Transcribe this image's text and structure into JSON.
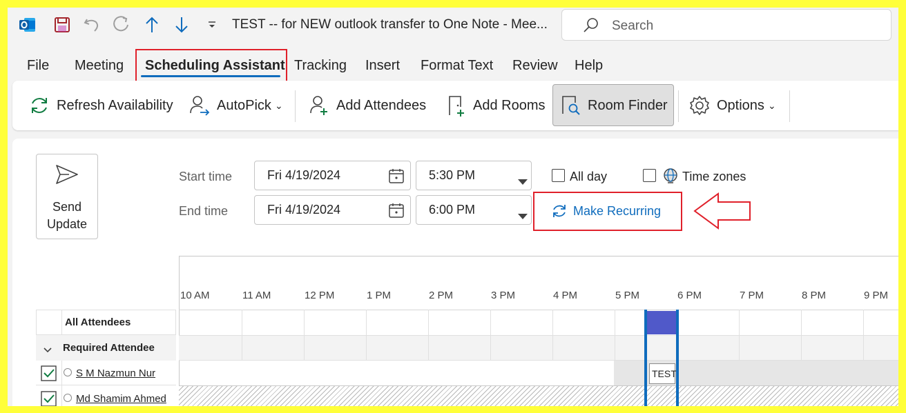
{
  "titlebar": {
    "title": "TEST -- for NEW outlook transfer to One Note  -  Mee...",
    "search_placeholder": "Search",
    "quick_access": [
      "outlook-logo-icon",
      "save-icon",
      "undo-icon",
      "redo-icon",
      "up-arrow-icon",
      "down-arrow-icon",
      "customize-dropdown-icon"
    ]
  },
  "tabs": [
    {
      "label": "File"
    },
    {
      "label": "Meeting"
    },
    {
      "label": "Scheduling Assistant",
      "active": true
    },
    {
      "label": "Tracking"
    },
    {
      "label": "Insert"
    },
    {
      "label": "Format Text"
    },
    {
      "label": "Review"
    },
    {
      "label": "Help"
    }
  ],
  "ribbon": {
    "refresh": "Refresh Availability",
    "autopick": "AutoPick",
    "add_attendees": "Add Attendees",
    "add_rooms": "Add Rooms",
    "room_finder": "Room Finder",
    "options": "Options"
  },
  "form": {
    "send_update_line1": "Send",
    "send_update_line2": "Update",
    "start_label": "Start time",
    "end_label": "End time",
    "start_date": "Fri 4/19/2024",
    "start_time": "5:30 PM",
    "end_date": "Fri 4/19/2024",
    "end_time": "6:00 PM",
    "all_day": "All day",
    "all_day_checked": false,
    "time_zones": "Time zones",
    "time_zones_checked": false,
    "make_recurring": "Make Recurring"
  },
  "schedule": {
    "hours": [
      "10 AM",
      "11 AM",
      "12 PM",
      "1 PM",
      "2 PM",
      "3 PM",
      "4 PM",
      "5 PM",
      "6 PM",
      "7 PM",
      "8 PM",
      "9 PM"
    ],
    "all_attendees": "All Attendees",
    "required_group": "Required Attendee",
    "attendees": [
      {
        "name": "S M Nazmun Nur",
        "checked": true,
        "busy_label": "TEST"
      },
      {
        "name": "Md Shamim Ahmed",
        "checked": true
      }
    ]
  },
  "colors": {
    "highlight": "#ffff3a",
    "accent": "#0f6cbd",
    "annotation_red": "#e0202a",
    "busy_block": "#5059c9",
    "link": "#0f6cbd"
  }
}
